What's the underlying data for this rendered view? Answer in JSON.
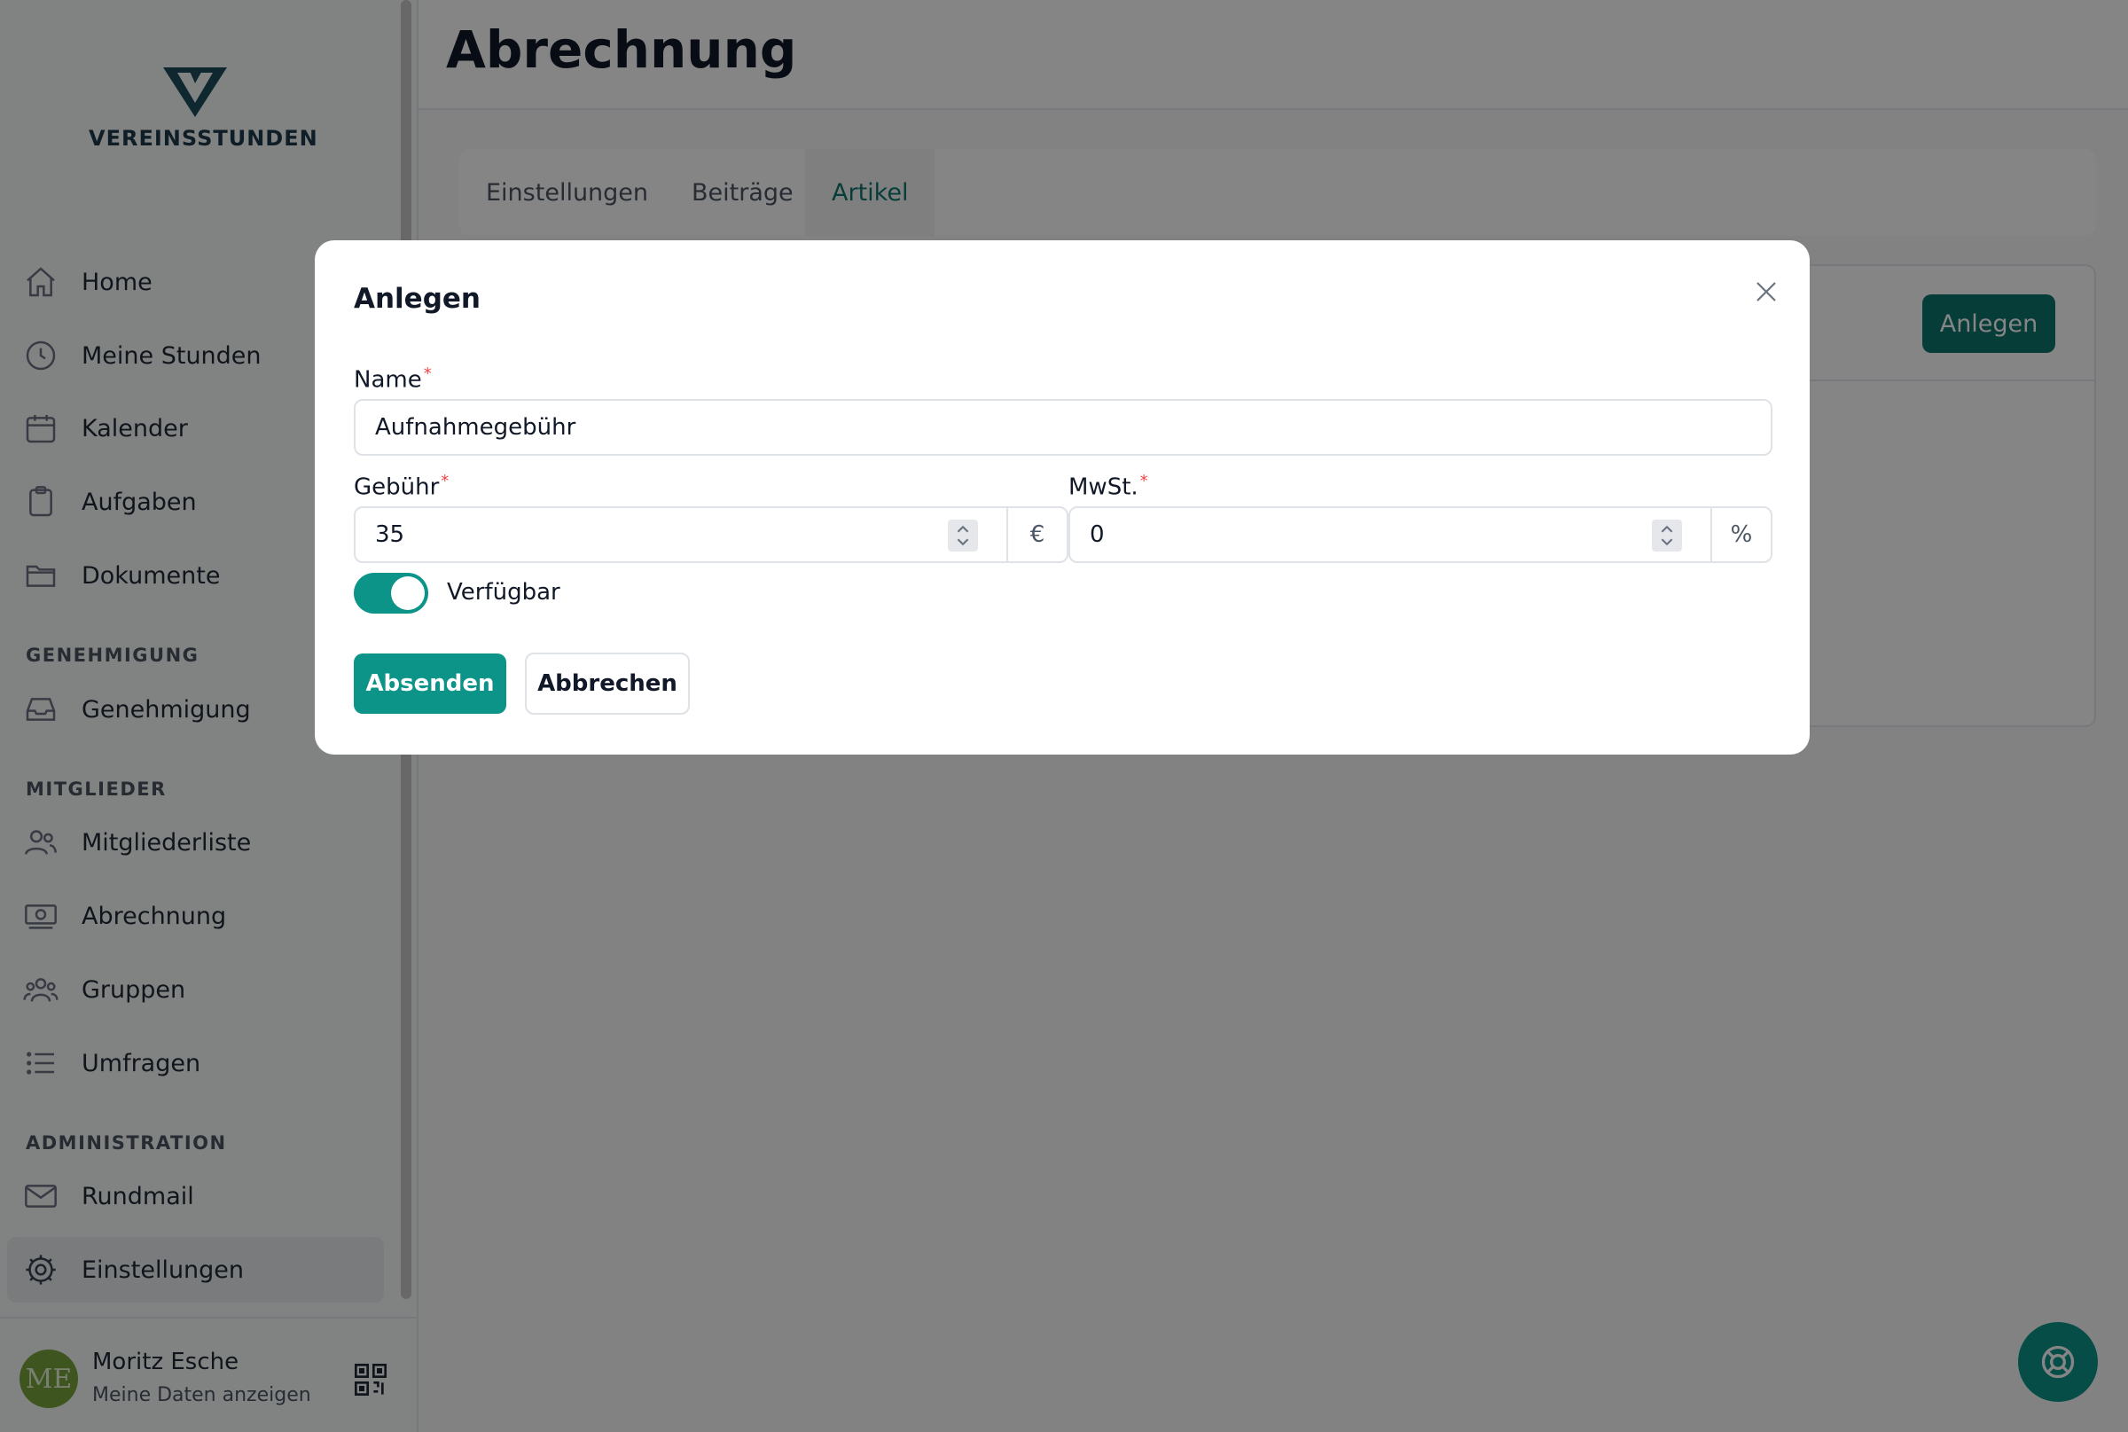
{
  "brand": {
    "name": "VEREINSSTUNDEN"
  },
  "page": {
    "title": "Abrechnung"
  },
  "tabs": [
    {
      "label": "Einstellungen"
    },
    {
      "label": "Beiträge"
    },
    {
      "label": "Artikel"
    }
  ],
  "content": {
    "create_button": "Anlegen"
  },
  "sidebar": {
    "items": [
      {
        "label": "Home"
      },
      {
        "label": "Meine Stunden"
      },
      {
        "label": "Kalender"
      },
      {
        "label": "Aufgaben"
      },
      {
        "label": "Dokumente"
      }
    ],
    "sections": [
      {
        "title": "GENEHMIGUNG",
        "items": [
          {
            "label": "Genehmigung"
          }
        ]
      },
      {
        "title": "MITGLIEDER",
        "items": [
          {
            "label": "Mitgliederliste"
          },
          {
            "label": "Abrechnung"
          },
          {
            "label": "Gruppen"
          },
          {
            "label": "Umfragen"
          }
        ]
      },
      {
        "title": "ADMINISTRATION",
        "items": [
          {
            "label": "Rundmail"
          },
          {
            "label": "Einstellungen"
          }
        ]
      }
    ]
  },
  "user": {
    "initials": "ME",
    "name": "Moritz Esche",
    "subtitle": "Meine Daten anzeigen"
  },
  "modal": {
    "title": "Anlegen",
    "fields": {
      "name": {
        "label": "Name",
        "value": "Aufnahmegebühr"
      },
      "fee": {
        "label": "Gebühr",
        "value": "35",
        "unit": "€"
      },
      "vat": {
        "label": "MwSt.",
        "value": "0",
        "unit": "%"
      }
    },
    "available": {
      "label": "Verfügbar",
      "checked": true
    },
    "submit": "Absenden",
    "cancel": "Abbrechen"
  },
  "colors": {
    "accent": "#0d9488",
    "accent_dark": "#0f766e",
    "required": "#ef4444"
  }
}
